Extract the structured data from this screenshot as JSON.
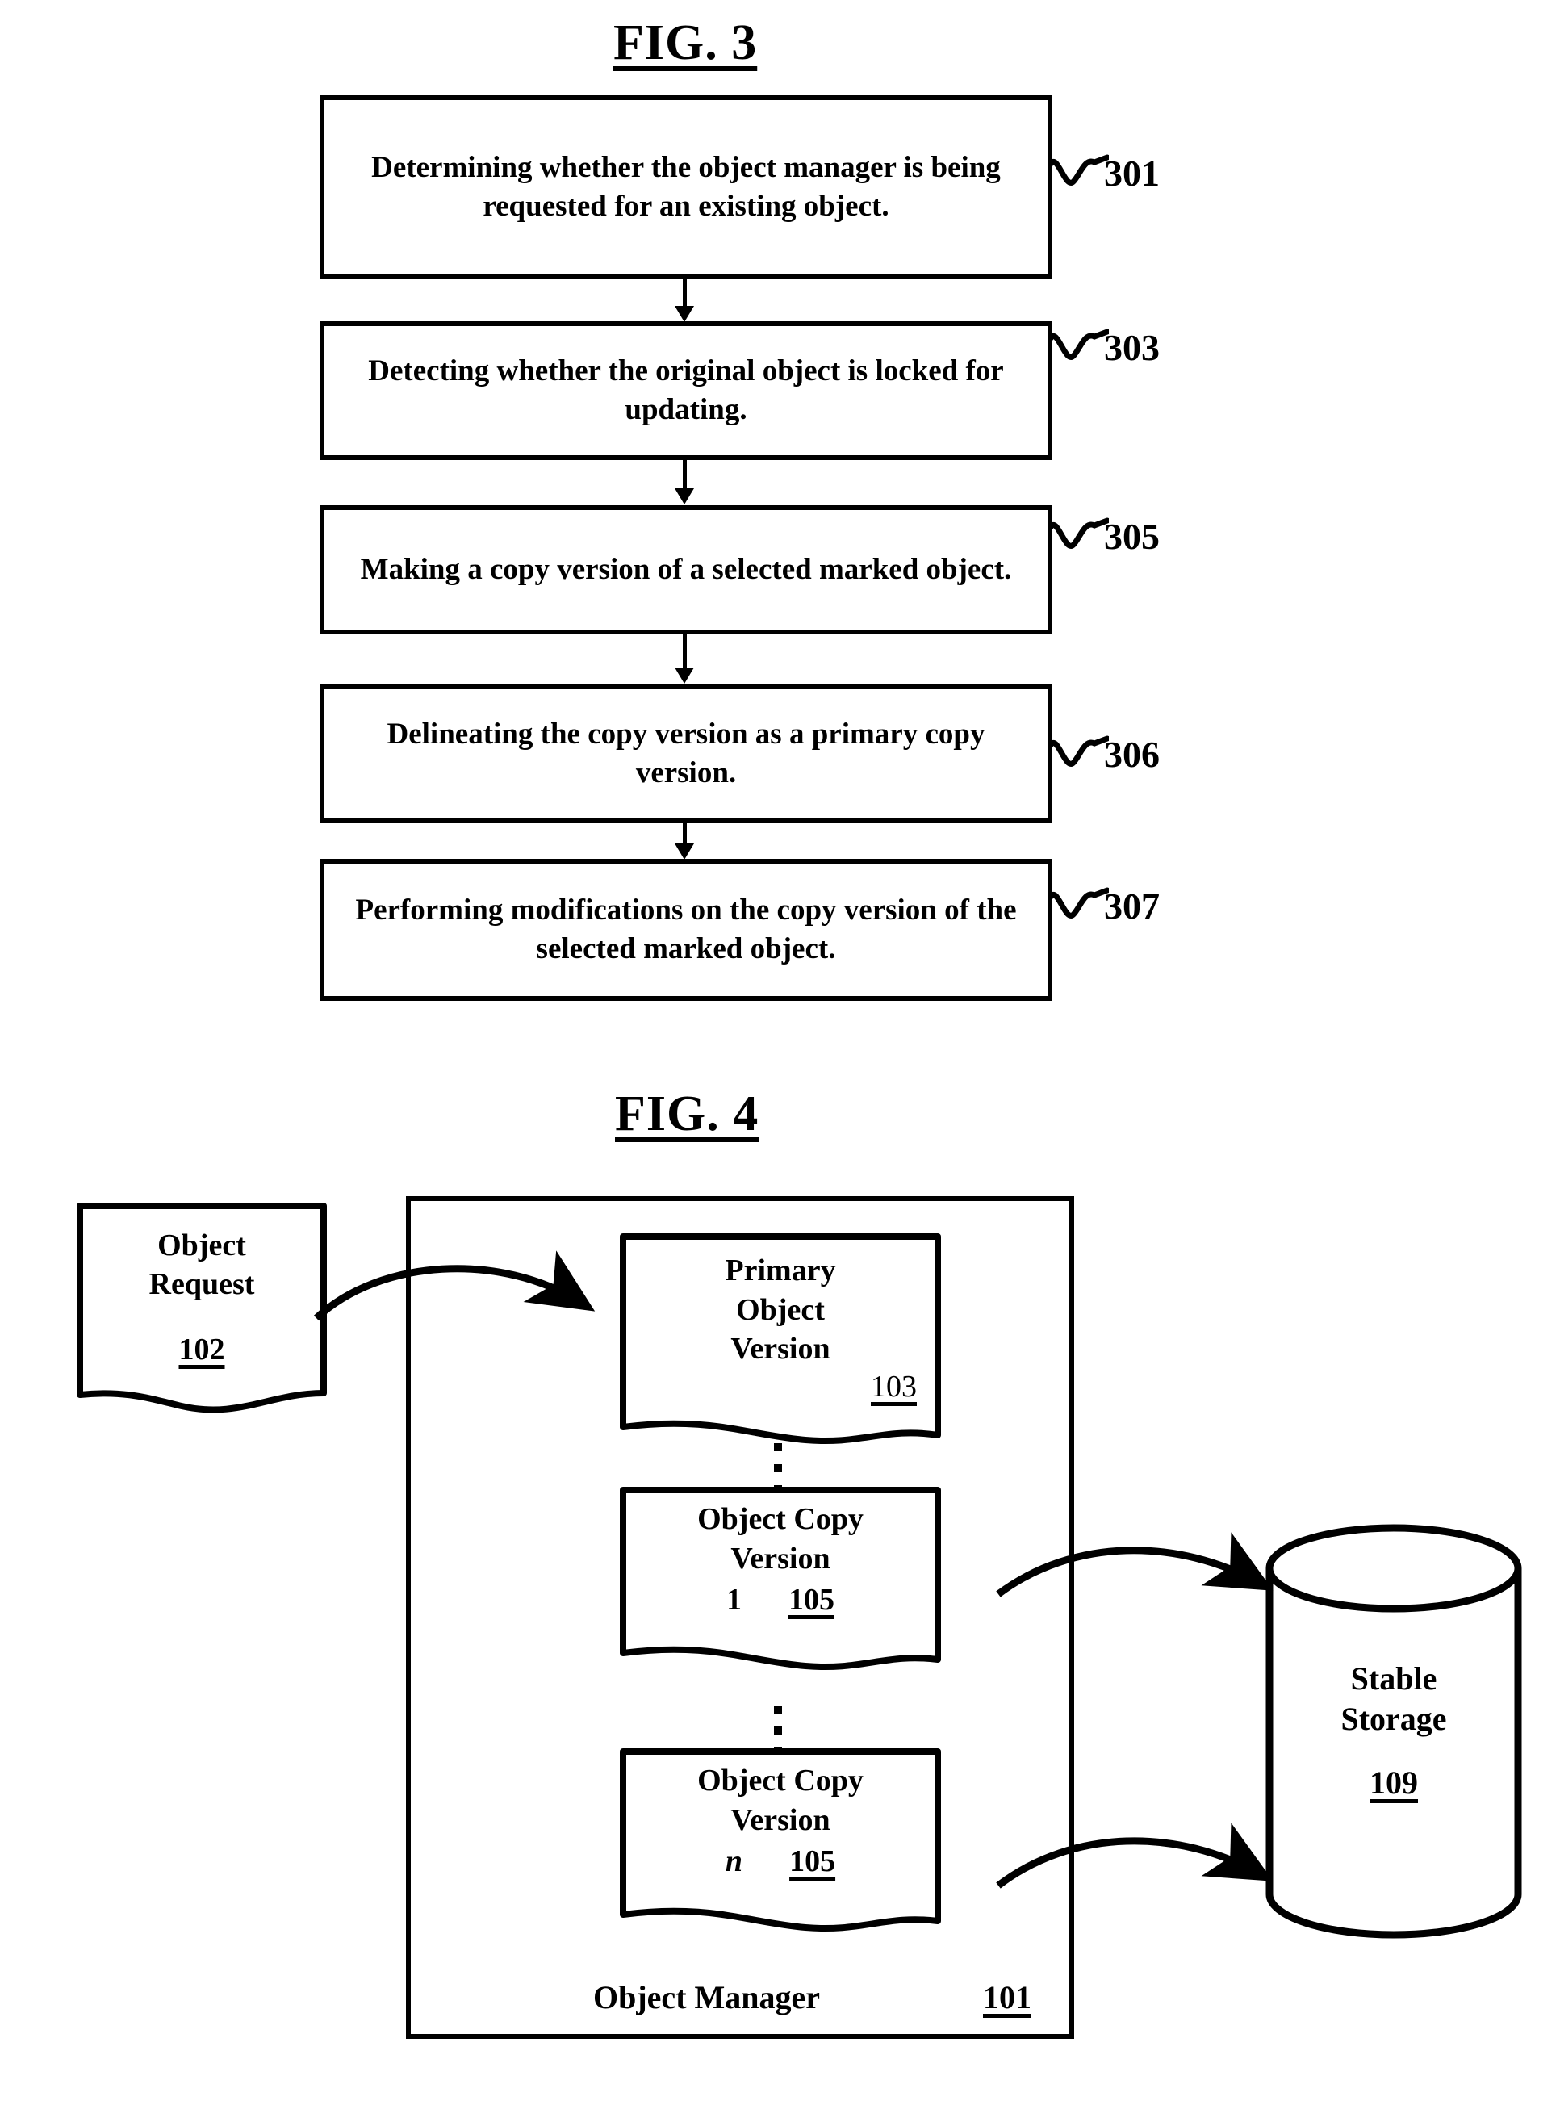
{
  "figures": [
    {
      "title": "FIG. 3",
      "steps": [
        {
          "text": "Determining whether the object manager is being requested for an existing object.",
          "ref": "301"
        },
        {
          "text": "Detecting whether the original object is locked for updating.",
          "ref": "303"
        },
        {
          "text": "Making a copy version of a selected marked object.",
          "ref": "305"
        },
        {
          "text": "Delineating the copy version as a primary copy version.",
          "ref": "306"
        },
        {
          "text": "Performing modifications on the copy version of the selected marked object.",
          "ref": "307"
        }
      ]
    },
    {
      "title": "FIG. 4",
      "object_request": {
        "line1": "Object",
        "line2": "Request",
        "ref": "102"
      },
      "object_manager": {
        "label": "Object Manager",
        "ref": "101"
      },
      "primary_object_version": {
        "line1": "Primary",
        "line2": "Object",
        "line3": "Version",
        "ref": "103"
      },
      "object_copy_version_1": {
        "line1": "Object Copy",
        "line2": "Version",
        "index": "1",
        "ref": "105"
      },
      "object_copy_version_n": {
        "line1": "Object Copy",
        "line2": "Version",
        "index": "n",
        "ref": "105"
      },
      "stable_storage": {
        "line1": "Stable",
        "line2": "Storage",
        "ref": "109"
      }
    }
  ],
  "fig3": {
    "title": "FIG. 3",
    "box301": "Determining whether the object manager is being requested for an existing object.",
    "box303": "Detecting whether the original object is locked for updating.",
    "box305": "Making a copy version of a selected marked object.",
    "box306": "Delineating the copy version as a primary copy version.",
    "box307": "Performing modifications on the copy version of the selected marked object.",
    "ref301": "301",
    "ref303": "303",
    "ref305": "305",
    "ref306": "306",
    "ref307": "307"
  },
  "fig4": {
    "title": "FIG. 4",
    "object_request_line1": "Object",
    "object_request_line2": "Request",
    "object_request_ref": "102",
    "object_manager_label": "Object Manager",
    "object_manager_ref": "101",
    "pov_line1": "Primary",
    "pov_line2": "Object",
    "pov_line3": "Version",
    "pov_ref": "103",
    "ocv1_line1": "Object Copy",
    "ocv1_line2": "Version",
    "ocv1_index": "1",
    "ocv1_ref": "105",
    "ocvn_line1": "Object Copy",
    "ocvn_line2": "Version",
    "ocvn_index": "n",
    "ocvn_ref": "105",
    "storage_line1": "Stable",
    "storage_line2": "Storage",
    "storage_ref": "109"
  },
  "colors": {
    "ink": "#000000",
    "paper": "#ffffff"
  }
}
